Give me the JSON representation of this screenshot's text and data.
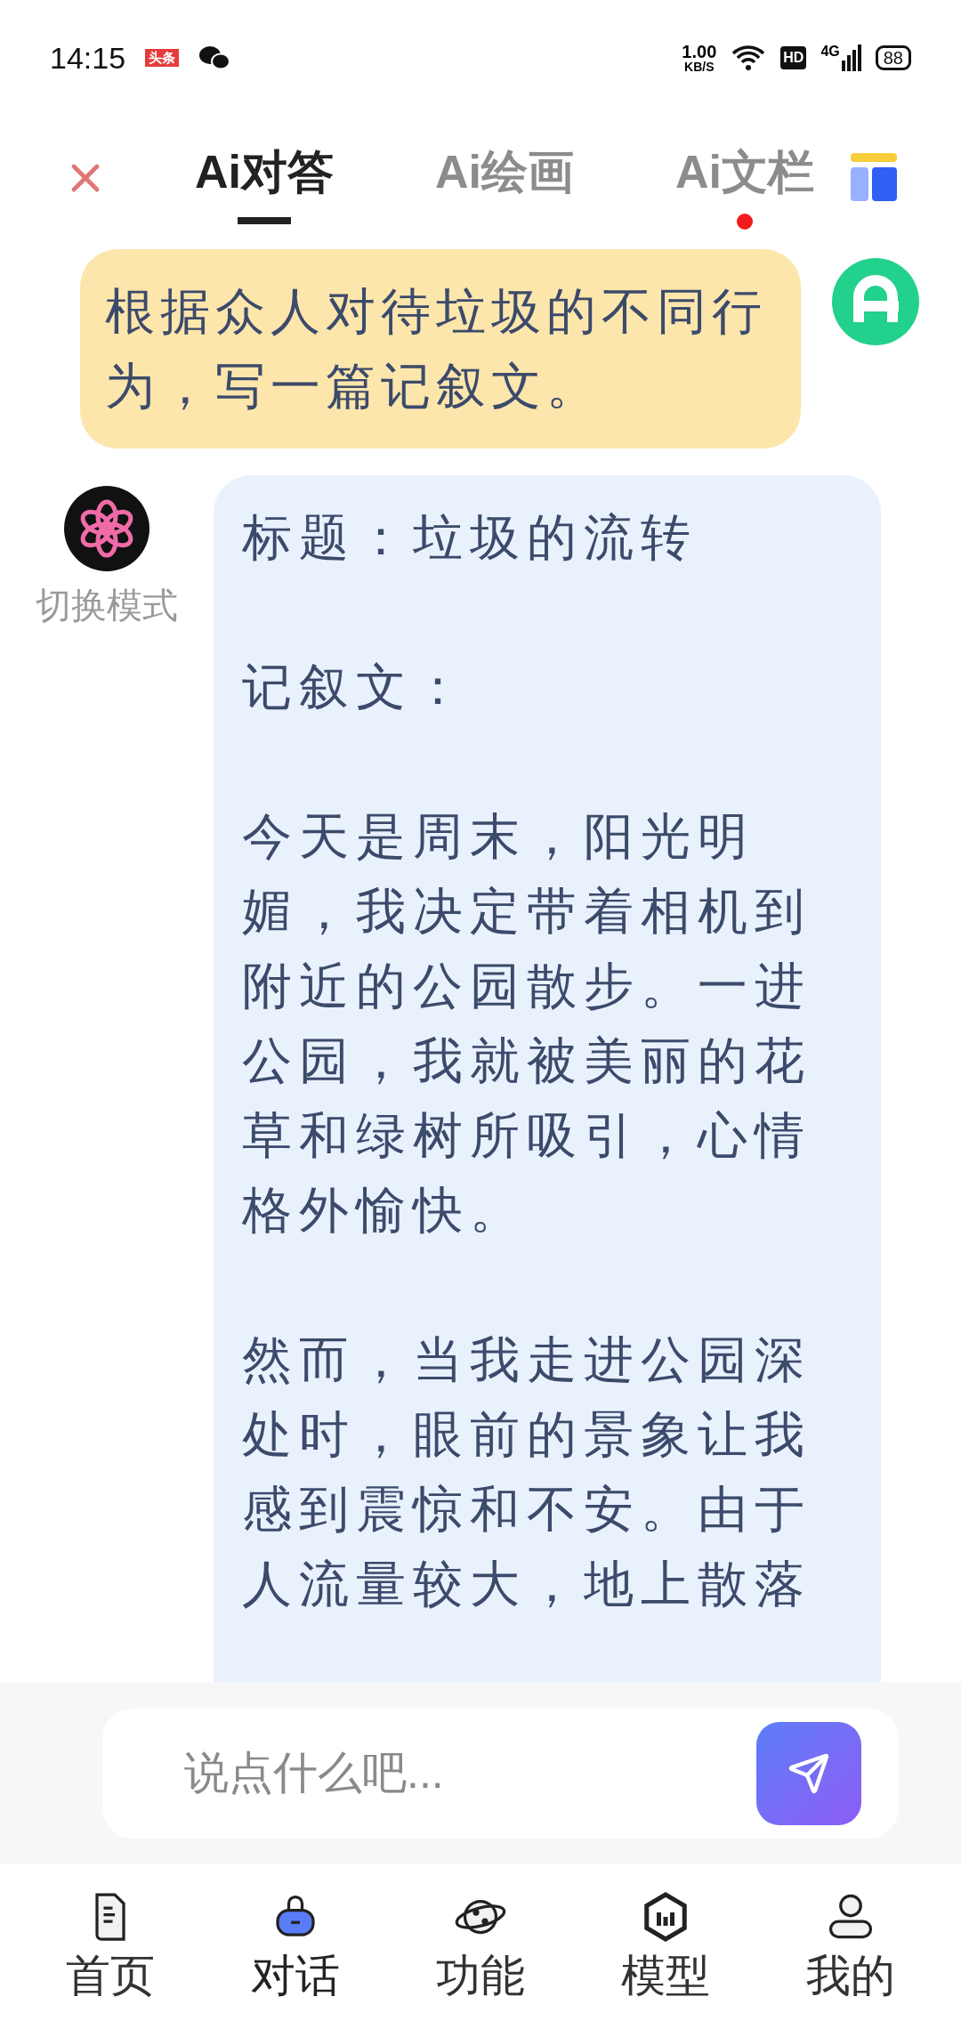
{
  "status_bar": {
    "time": "14:15",
    "news_badge": "头条",
    "speed_value": "1.00",
    "speed_unit": "KB/S",
    "hd": "HD",
    "network": "4G",
    "battery": "88"
  },
  "tabs": [
    {
      "label": "Ai对答",
      "selected": true,
      "dot": false
    },
    {
      "label": "Ai绘画",
      "selected": false,
      "dot": false
    },
    {
      "label": "Ai文栏",
      "selected": false,
      "dot": true
    }
  ],
  "messages": [
    {
      "kind": "user",
      "paragraphs": [
        "根据众人对待垃圾的不同行为，写一篇记叙文。"
      ]
    },
    {
      "kind": "ai",
      "avatar_label": "切换模式",
      "paragraphs": [
        "标题：垃圾的流转",
        "记叙文：",
        "今天是周末，阳光明媚，我决定带着相机到附近的公园散步。一进公园，我就被美丽的花草和绿树所吸引，心情格外愉快。",
        "然而，当我走进公园深处时，眼前的景象让我感到震惊和不安。由于人流量较大，地上散落"
      ]
    }
  ],
  "input": {
    "placeholder": "说点什么吧..."
  },
  "bottom_nav": [
    {
      "label": "首页",
      "selected": false
    },
    {
      "label": "对话",
      "selected": true
    },
    {
      "label": "功能",
      "selected": false
    },
    {
      "label": "模型",
      "selected": false
    },
    {
      "label": "我的",
      "selected": false
    }
  ]
}
